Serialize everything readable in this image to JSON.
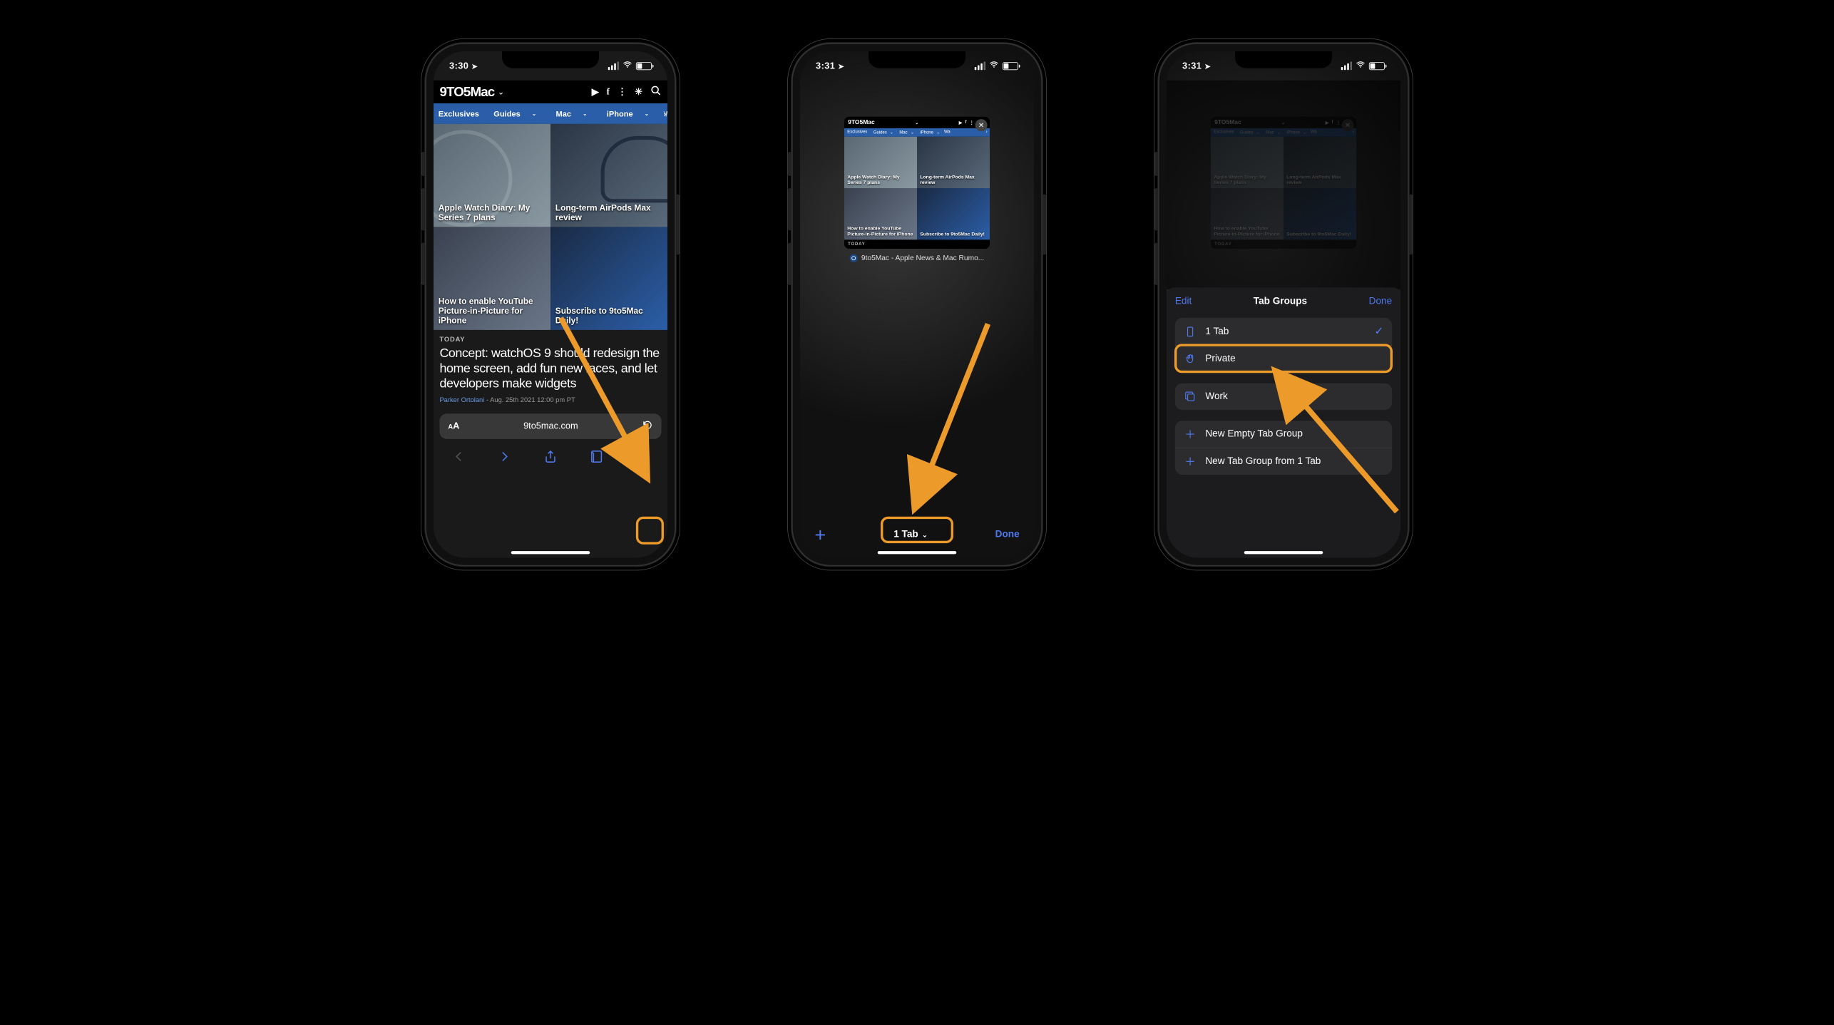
{
  "phone1": {
    "time": "3:30",
    "brand": "9TO5Mac",
    "nav": [
      "Exclusives",
      "Guides",
      "Mac",
      "iPhone",
      "Wa"
    ],
    "tiles": [
      "Apple Watch Diary: My Series 7 plans",
      "Long-term AirPods Max review",
      "How to enable YouTube Picture-in-Picture for iPhone",
      "Subscribe to 9to5Mac Daily!"
    ],
    "today": "TODAY",
    "headline": "Concept: watchOS 9 should redesign the home screen, add fun new faces, and let developers make widgets",
    "author": "Parker Ortolani",
    "date": "- Aug. 25th 2021 12:00 pm PT",
    "url": "9to5mac.com"
  },
  "phone2": {
    "time": "3:31",
    "tab_title": "9to5Mac - Apple News & Mac Rumo...",
    "count": "1 Tab",
    "done": "Done",
    "tiles": [
      "Apple Watch Diary: My Series 7 plans",
      "Long-term AirPods Max review",
      "How to enable YouTube Picture-in-Picture for iPhone",
      "Subscribe to 9to5Mac Daily!"
    ]
  },
  "phone3": {
    "time": "3:31",
    "edit": "Edit",
    "title": "Tab Groups",
    "done": "Done",
    "rows": {
      "one": "1 Tab",
      "private": "Private",
      "work": "Work",
      "new_empty": "New Empty Tab Group",
      "new_from": "New Tab Group from 1 Tab"
    }
  }
}
